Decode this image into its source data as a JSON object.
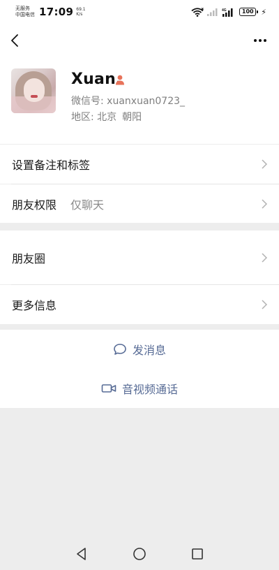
{
  "status_bar": {
    "carrier_line1": "无服务",
    "carrier_line2": "中国电信",
    "time": "17:09",
    "net_speed_value": "69.1",
    "net_speed_unit": "K/s",
    "network_type": "4G",
    "battery": "100"
  },
  "nav": {
    "back_icon": "chevron-left-icon",
    "more_icon": "ellipsis-icon"
  },
  "profile": {
    "nickname": "Xuan.",
    "gender_icon": "female-person-icon",
    "wechat_id_label": "微信号:",
    "wechat_id": "xuanxuan0723_",
    "region_label": "地区:",
    "region_city": "北京",
    "region_district": "朝阳"
  },
  "rows": {
    "remark_tags": {
      "label": "设置备注和标签"
    },
    "permissions": {
      "label": "朋友权限",
      "value": "仅聊天"
    },
    "moments": {
      "label": "朋友圈"
    },
    "more_info": {
      "label": "更多信息"
    }
  },
  "actions": {
    "send_message": "发消息",
    "av_call": "音视频通话"
  },
  "colors": {
    "link": "#576b95",
    "background": "#ededed",
    "gender_female": "#e8735a"
  }
}
